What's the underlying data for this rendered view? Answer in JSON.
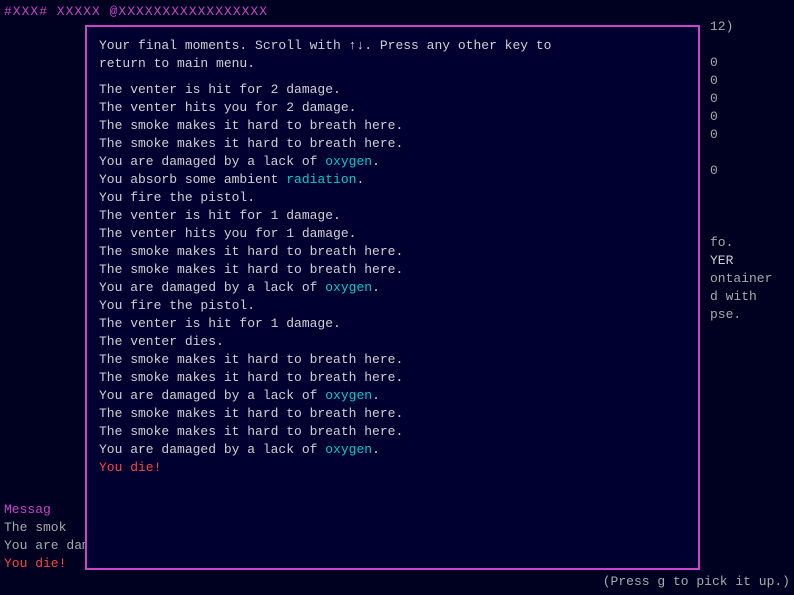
{
  "topbar": {
    "text": "#XXX#    XXXXX    @XXXXXXXXXXXXXXXXX"
  },
  "modal": {
    "header": "Your final moments. Scroll with ↑↓. Press any other key to\nreturn to main menu.",
    "lines": [
      {
        "text": "The venter is hit for 2 damage.",
        "color": "white"
      },
      {
        "text": "The venter hits you for 2 damage.",
        "color": "white"
      },
      {
        "text": "The smoke makes it hard to breath here.",
        "color": "white"
      },
      {
        "text": "The smoke makes it hard to breath here.",
        "color": "white"
      },
      {
        "text_parts": [
          {
            "text": "You are damaged by a lack of ",
            "color": "white"
          },
          {
            "text": "oxygen",
            "color": "cyan"
          },
          {
            "text": ".",
            "color": "white"
          }
        ]
      },
      {
        "text_parts": [
          {
            "text": "You absorb some ambient ",
            "color": "white"
          },
          {
            "text": "radiation",
            "color": "cyan"
          },
          {
            "text": ".",
            "color": "white"
          }
        ]
      },
      {
        "text": "You fire the pistol.",
        "color": "white"
      },
      {
        "text": "The venter is hit for 1 damage.",
        "color": "white"
      },
      {
        "text": "The venter hits you for 1 damage.",
        "color": "white"
      },
      {
        "text": "The smoke makes it hard to breath here.",
        "color": "white"
      },
      {
        "text": "The smoke makes it hard to breath here.",
        "color": "white"
      },
      {
        "text_parts": [
          {
            "text": "You are damaged by a lack of ",
            "color": "white"
          },
          {
            "text": "oxygen",
            "color": "cyan"
          },
          {
            "text": ".",
            "color": "white"
          }
        ]
      },
      {
        "text": "You fire the pistol.",
        "color": "white"
      },
      {
        "text": "The venter is hit for 1 damage.",
        "color": "white"
      },
      {
        "text": "The venter dies.",
        "color": "white"
      },
      {
        "text": "The smoke makes it hard to breath here.",
        "color": "white"
      },
      {
        "text": "The smoke makes it hard to breath here.",
        "color": "white"
      },
      {
        "text_parts": [
          {
            "text": "You are damaged by a lack of ",
            "color": "white"
          },
          {
            "text": "oxygen",
            "color": "cyan"
          },
          {
            "text": ".",
            "color": "white"
          }
        ]
      },
      {
        "text": "The smoke makes it hard to breath here.",
        "color": "white"
      },
      {
        "text": "The smoke makes it hard to breath here.",
        "color": "white"
      },
      {
        "text_parts": [
          {
            "text": "You are damaged by a lack of ",
            "color": "white"
          },
          {
            "text": "oxygen",
            "color": "cyan"
          },
          {
            "text": ".",
            "color": "white"
          }
        ]
      },
      {
        "text": "You die!",
        "color": "red"
      }
    ]
  },
  "background": {
    "top_line": "#XXX#    XXXXX    @XXXXXXXXXXXXXXXXX",
    "right_col_top": "12)",
    "right_zeros": [
      "0",
      "0",
      "0",
      "0",
      "0"
    ],
    "right_zero2": "0",
    "right_texts": [
      "fo.",
      "YER",
      "ontainer",
      "d with",
      "pse."
    ],
    "bottom_lines": [
      "Messag",
      "The smok",
      "You are damaged by a lack of oxygen.",
      "You die!"
    ],
    "pickup_hint": "(Press g to pick it up.)"
  },
  "colors": {
    "border": "#cc44cc",
    "bg": "#000020",
    "text_default": "#d0d0d0",
    "cyan": "#00cccc",
    "red": "#ff4444",
    "magenta": "#cc44cc"
  }
}
